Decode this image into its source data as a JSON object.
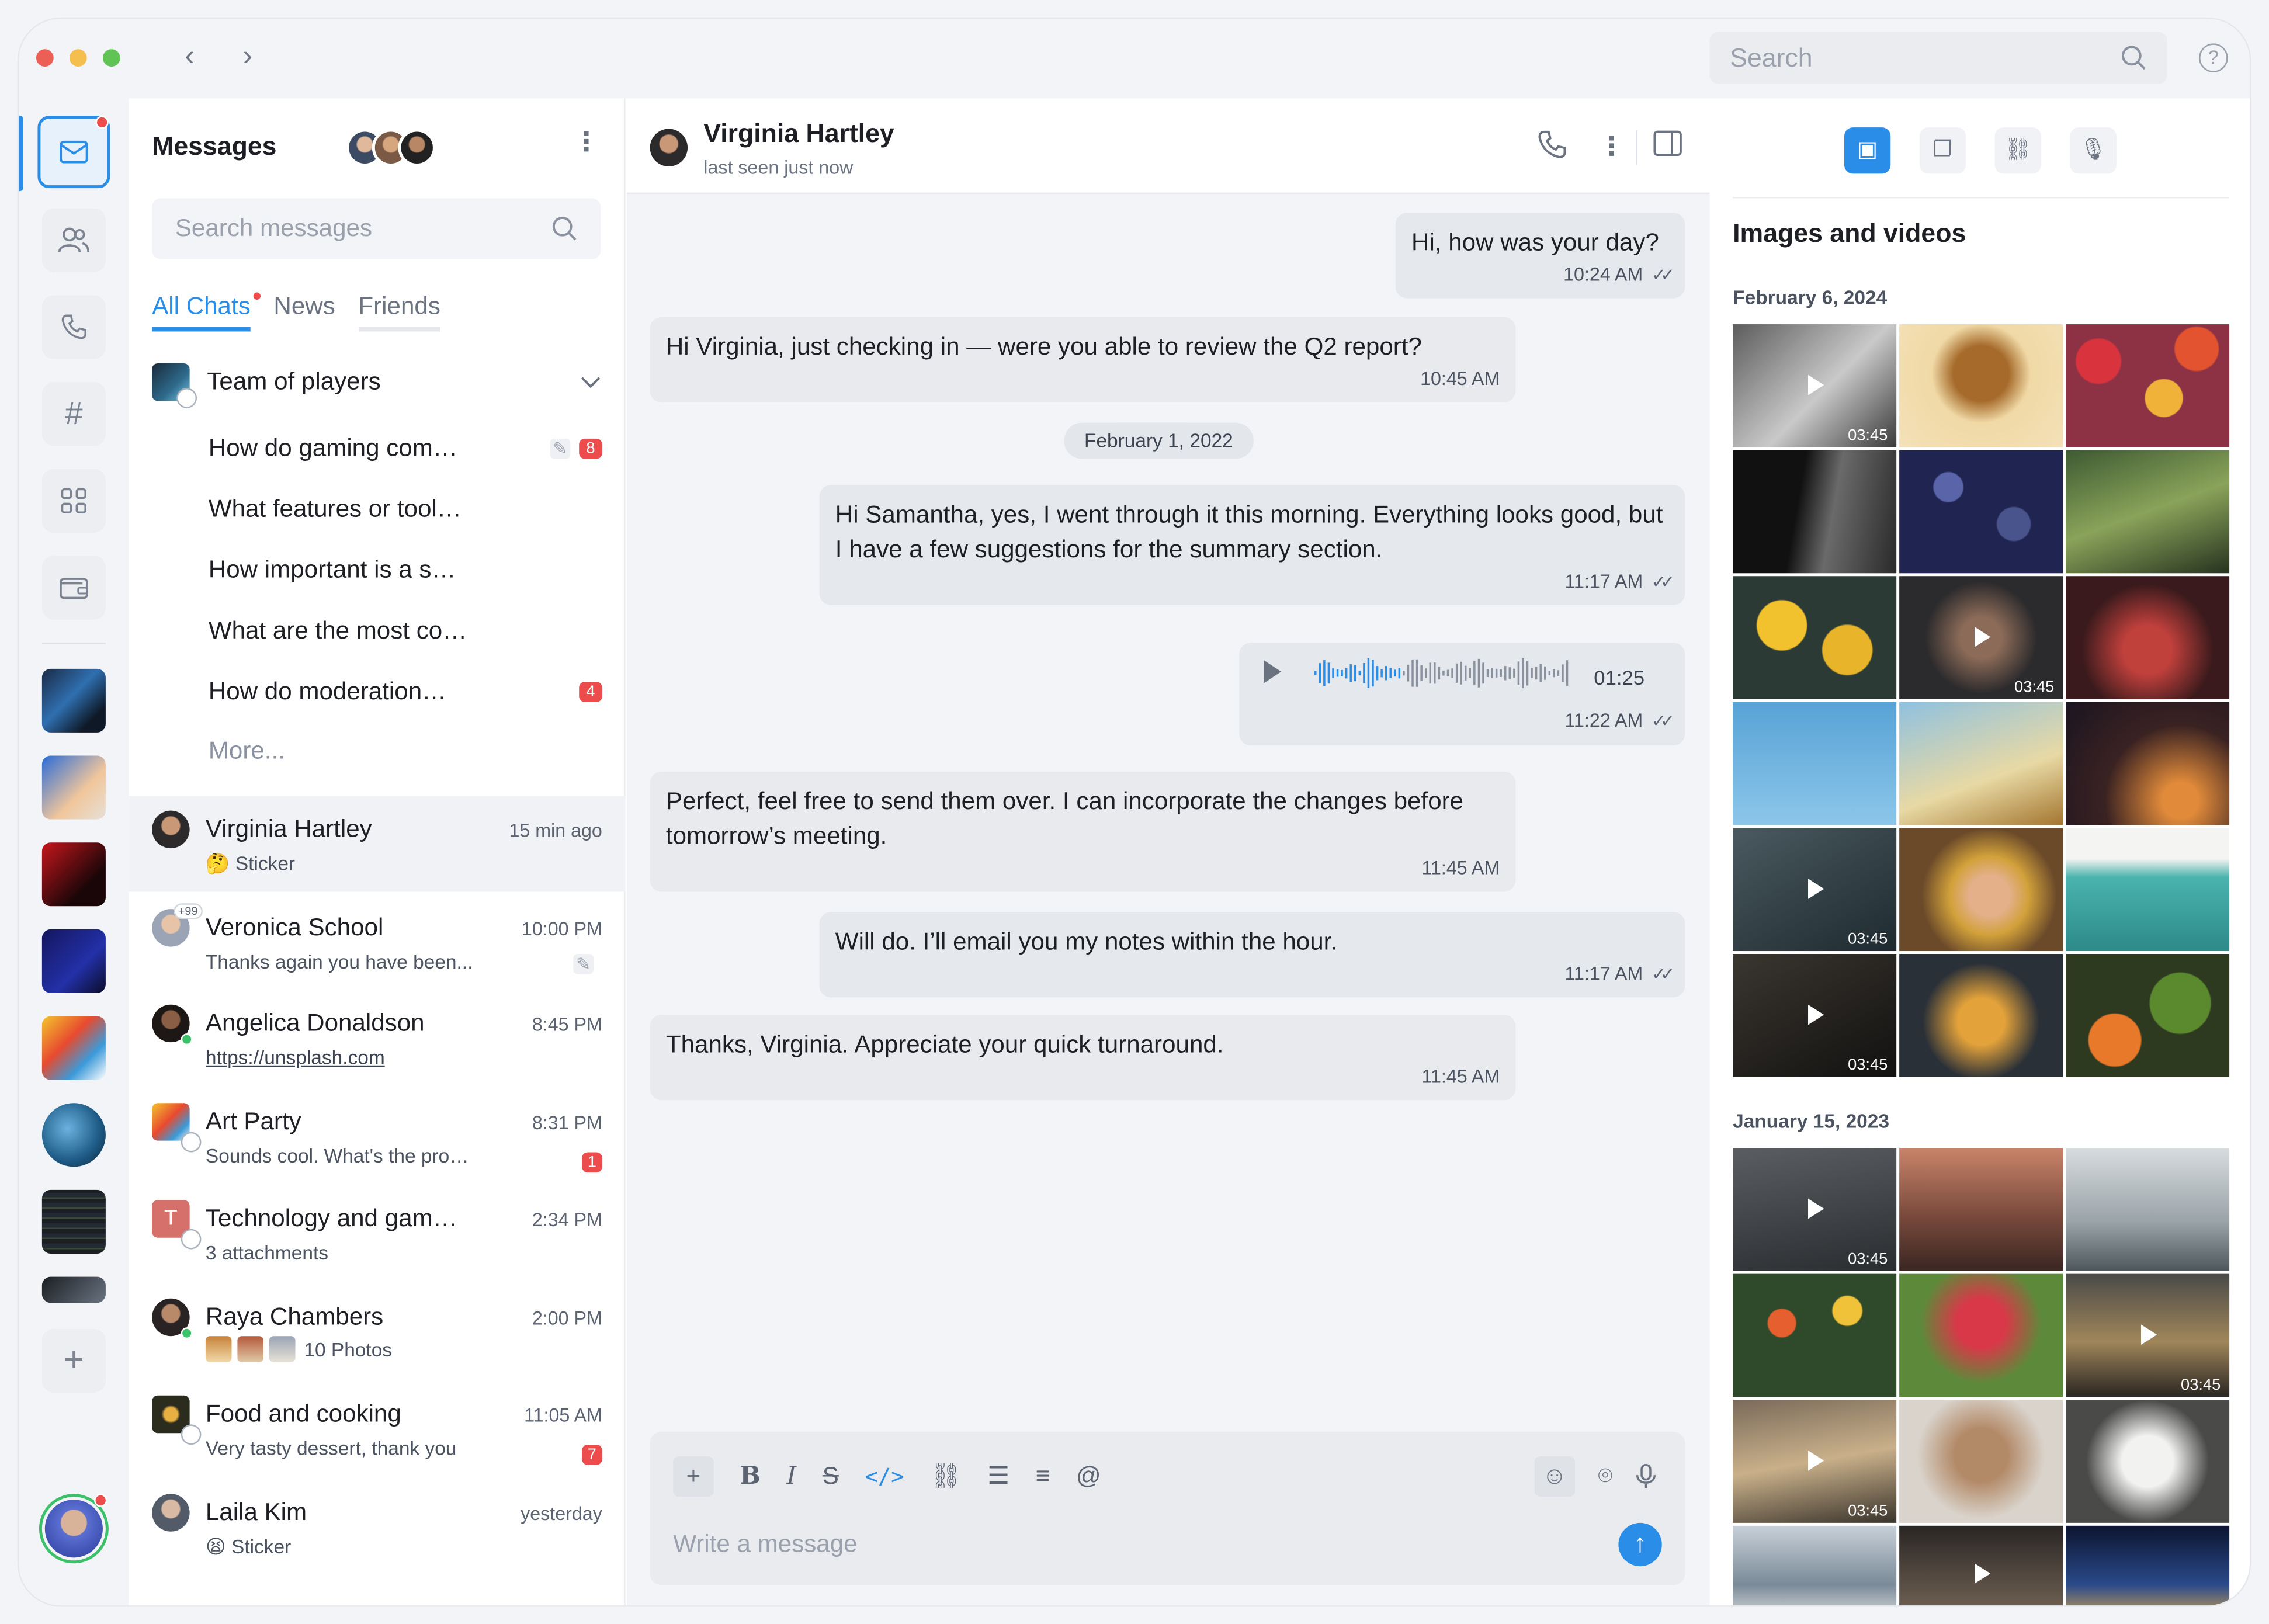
{
  "topbar": {
    "search_placeholder": "Search"
  },
  "sidebar": {
    "items": [
      {
        "name": "messages",
        "icon": "mail-icon"
      },
      {
        "name": "contacts",
        "icon": "users-icon"
      },
      {
        "name": "calls",
        "icon": "phone-icon"
      },
      {
        "name": "channels",
        "icon": "hashtag-icon"
      },
      {
        "name": "apps",
        "icon": "grid-icon"
      },
      {
        "name": "wallet",
        "icon": "wallet-icon"
      }
    ]
  },
  "chatlist": {
    "title": "Messages",
    "search_placeholder": "Search messages",
    "tabs": [
      "All Chats",
      "News",
      "Friends"
    ],
    "group": {
      "name": "Team of players",
      "threads": [
        {
          "text": "How do gaming com…",
          "badge": "8",
          "draft": true
        },
        {
          "text": "What features or tool…",
          "badge": ""
        },
        {
          "text": "How important is a s…",
          "badge": ""
        },
        {
          "text": "What are the most co…",
          "badge": ""
        },
        {
          "text": "How do moderation…",
          "badge": "4"
        }
      ],
      "more": "More..."
    },
    "chats": [
      {
        "name": "Virginia Hartley",
        "time": "15 min ago",
        "preview": "🤔 Sticker",
        "badge": ""
      },
      {
        "name": "Veronica School",
        "time": "10:00 PM",
        "preview": "Thanks again you have been...",
        "badge": "",
        "avatar_tag": "+99"
      },
      {
        "name": "Angelica Donaldson",
        "time": "8:45 PM",
        "preview": "https://unsplash.com",
        "badge": ""
      },
      {
        "name": "Art Party",
        "time": "8:31 PM",
        "preview": "Sounds cool. What's the pro…",
        "badge": "1"
      },
      {
        "name": "Technology and gam…",
        "time": "2:34 PM",
        "preview": "3 attachments",
        "badge": "",
        "initial": "T"
      },
      {
        "name": "Raya Chambers",
        "time": "2:00 PM",
        "preview": "10 Photos",
        "badge": ""
      },
      {
        "name": "Food and cooking",
        "time": "11:05 AM",
        "preview": "Very tasty dessert, thank you",
        "badge": "7"
      },
      {
        "name": "Laila Kim",
        "time": "yesterday",
        "preview": "😫 Sticker",
        "badge": ""
      }
    ]
  },
  "conversation": {
    "name": "Virginia Hartley",
    "status": "last seen just now",
    "messages": [
      {
        "dir": "out",
        "text": "Hi, how was your day?",
        "time": "10:24 AM"
      },
      {
        "dir": "in",
        "text": "Hi Virginia, just checking in — were you able to review the Q2 report?",
        "time": "10:45 AM"
      },
      {
        "dir": "out",
        "text": "Hi Samantha, yes, I went through it this morning. Everything looks good, but I have a few suggestions for the summary section.",
        "time": "11:17 AM"
      },
      {
        "dir": "out",
        "voice_duration": "01:25",
        "time": "11:22 AM"
      },
      {
        "dir": "in",
        "text": "Perfect, feel free to send them over. I can incorporate the changes before tomorrow’s meeting.",
        "time": "11:45 AM"
      },
      {
        "dir": "out",
        "text": "Will do. I’ll email you my notes within the hour.",
        "time": "11:17 AM"
      },
      {
        "dir": "in",
        "text": "Thanks, Virginia. Appreciate your quick turnaround.",
        "time": "11:45 AM"
      }
    ],
    "date_separator": "February 1, 2022",
    "composer_placeholder": "Write a message"
  },
  "media": {
    "title": "Images and videos",
    "sections": [
      {
        "date": "February 6, 2024",
        "duration": "03:45"
      },
      {
        "date": "January 15, 2023",
        "duration": "03:45"
      }
    ]
  },
  "colors": {
    "accent": "#2a8ee8",
    "badge": "#ec4c4c",
    "online": "#3cc16a"
  }
}
